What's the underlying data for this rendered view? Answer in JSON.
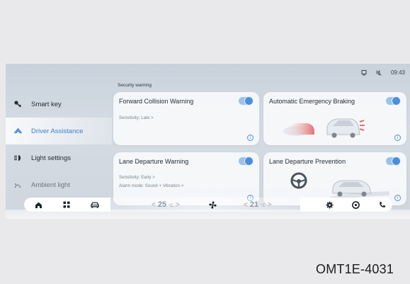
{
  "status_bar": {
    "icons": [
      "display-icon",
      "mute-icon"
    ],
    "time": "09:43"
  },
  "sidebar": {
    "items": [
      {
        "label": "Smart key",
        "icon": "key-icon",
        "active": false
      },
      {
        "label": "Driver Assistance",
        "icon": "car-assist-icon",
        "active": true
      },
      {
        "label": "Light settings",
        "icon": "headlight-icon",
        "active": false
      },
      {
        "label": "Ambient light",
        "icon": "ambient-light-icon",
        "active": false
      }
    ]
  },
  "main": {
    "section_label": "Security warning",
    "cards": [
      {
        "title": "Forward Collision Warning",
        "enabled": true,
        "lines": [
          "Sensitivity:  Late   >"
        ]
      },
      {
        "title": "Automatic Emergency Braking",
        "enabled": true,
        "lines": []
      },
      {
        "title": "Lane Departure Warning",
        "enabled": true,
        "lines": [
          "Sensitivity:  Early   >",
          "Alarm mode:  Sound + Vibration   >"
        ]
      },
      {
        "title": "Lane Departure Prevention",
        "enabled": true,
        "lines": []
      }
    ]
  },
  "dock": {
    "left_icons": [
      "home-icon",
      "apps-grid-icon",
      "car-icon"
    ],
    "left_temp": {
      "prev": "<",
      "value": "25",
      "unit": "°C",
      "next": ">"
    },
    "fan_icon": "fan-icon",
    "right_temp": {
      "prev": "<",
      "value": "21",
      "unit": "°C",
      "next": ">"
    },
    "right_icons": [
      "settings-icon",
      "music-icon",
      "phone-icon"
    ]
  },
  "colors": {
    "accent": "#4b8fdc",
    "active_text": "#3c7fd0"
  },
  "caption": "OMT1E-4031"
}
